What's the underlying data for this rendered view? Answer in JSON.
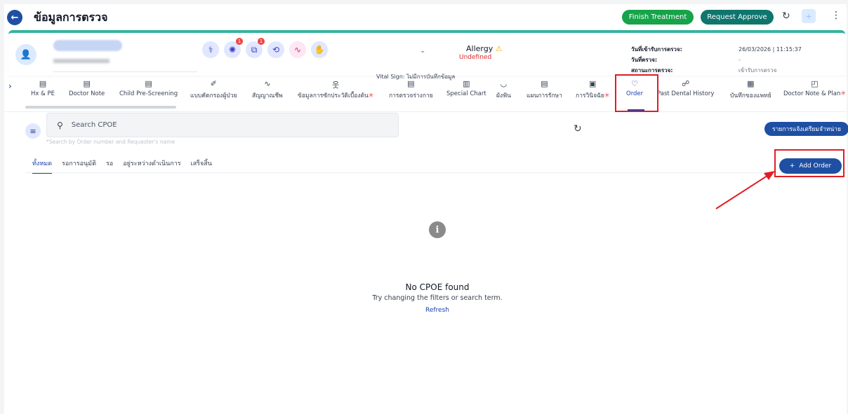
{
  "header": {
    "title": "ข้อมูลการตรวจ",
    "finish_label": "Finish Treatment",
    "approve_label": "Request Approve"
  },
  "patient": {
    "badges": {
      "icon2": "1",
      "icon3": "1"
    },
    "vital_sign": "Vital Sign: ไม่มีการบันทึกข้อมูล",
    "allergy_title": "Allergy",
    "allergy_value": "Undefined",
    "info": [
      {
        "label": "วันที่เข้ารับการตรวจ:",
        "value": "26/03/2026 | 11:15:37"
      },
      {
        "label": "วันที่ตรวจ:",
        "value": "-"
      },
      {
        "label": "สถานะการตรวจ:",
        "value": "เข้ารับการตรวจ"
      }
    ]
  },
  "tabs": [
    {
      "label": "Hx & PE",
      "icon": "document-icon",
      "required": false
    },
    {
      "label": "Doctor Note",
      "icon": "document-icon",
      "required": false
    },
    {
      "label": "Child Pre-Screening",
      "icon": "document-icon",
      "required": false
    },
    {
      "label": "แบบคัดกรองผู้ป่วย",
      "icon": "stethoscope-icon",
      "required": false
    },
    {
      "label": "สัญญาณชีพ",
      "icon": "pulse-icon",
      "required": false
    },
    {
      "label": "ข้อมูลการซักประวัติเบื้องต้น",
      "icon": "person-icon",
      "required": true
    },
    {
      "label": "การตรวจร่างกาย",
      "icon": "document-icon",
      "required": false
    },
    {
      "label": "Special Chart",
      "icon": "chart-icon",
      "required": false
    },
    {
      "label": "ผังฟัน",
      "icon": "tooth-icon",
      "required": false
    },
    {
      "label": "แผนการรักษา",
      "icon": "plan-icon",
      "required": false
    },
    {
      "label": "การวินิจฉัย",
      "icon": "diagnosis-icon",
      "required": true
    },
    {
      "label": "Order",
      "icon": "stethoscope-icon",
      "required": false,
      "active": true
    },
    {
      "label": "Past Dental History",
      "icon": "dental-icon",
      "required": false
    },
    {
      "label": "บันทึกของแพทย์",
      "icon": "calendar-icon",
      "required": false
    },
    {
      "label": "Doctor Note & Plan",
      "icon": "note-icon",
      "required": true
    }
  ],
  "search": {
    "placeholder": "Search CPOE",
    "hint": "*Search by Order number and Requester's name"
  },
  "discharge_label": "รายการแจ้งเตรียมจำหน่าย",
  "filter_tabs": [
    {
      "label": "ทั้งหมด",
      "active": true
    },
    {
      "label": "รอการอนุมัติ"
    },
    {
      "label": "รอ"
    },
    {
      "label": "อยู่ระหว่างดำเนินการ"
    },
    {
      "label": "เสร็จสิ้น"
    }
  ],
  "add_order_label": "Add Order",
  "empty": {
    "title": "No CPOE found",
    "subtitle": "Try changing the filters or search term.",
    "refresh_label": "Refresh"
  },
  "colors": {
    "primary": "#1e4fa3",
    "finish": "#16a34a",
    "approve": "#0f766e",
    "accent_bar": "#34b3a0",
    "annotation_red": "#e11d25"
  }
}
